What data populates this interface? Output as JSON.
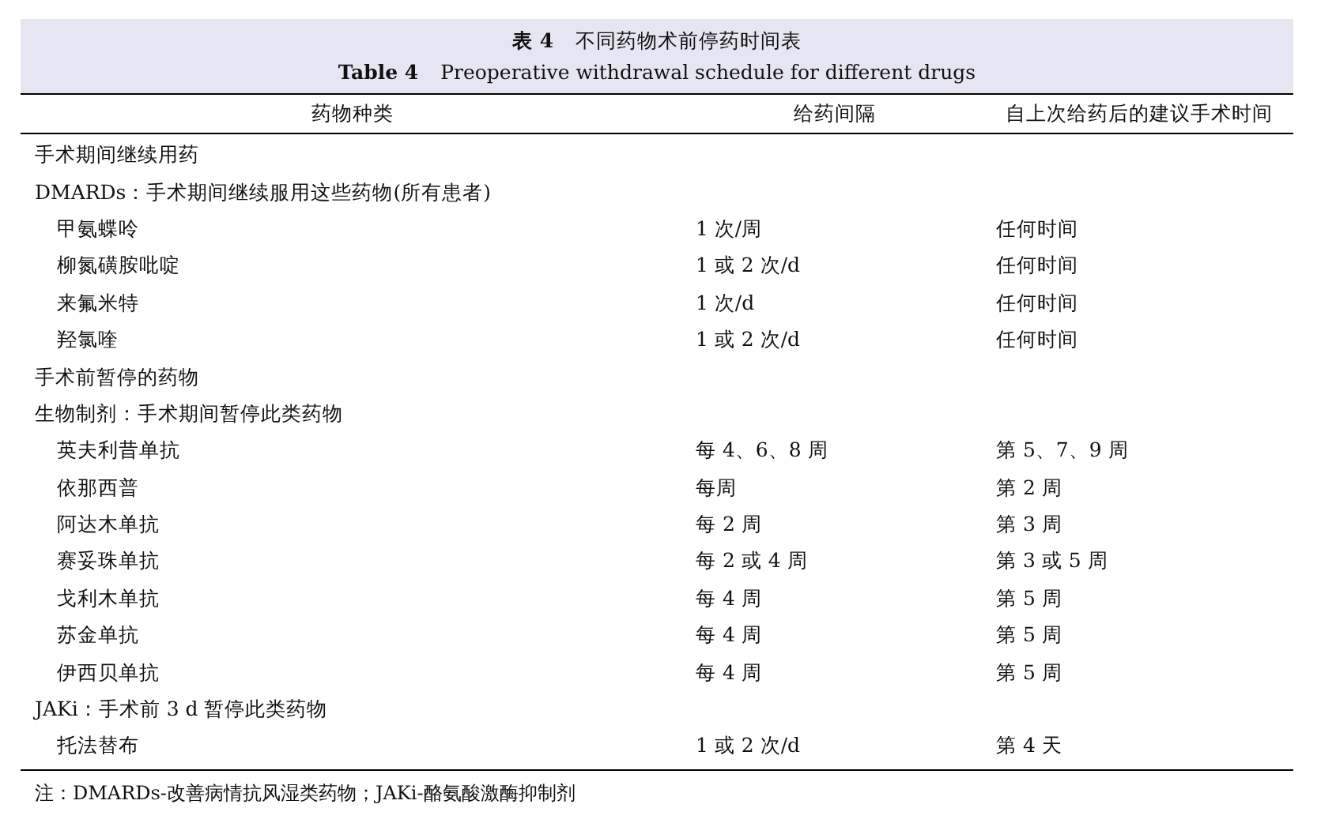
{
  "caption": {
    "label_zh": "表 4",
    "title_zh": "不同药物术前停药时间表",
    "label_en": "Table 4",
    "title_en": "Preoperative withdrawal schedule for different drugs"
  },
  "table": {
    "columns": [
      "药物种类",
      "给药间隔",
      "自上次给药后的建议手术时间"
    ],
    "rows": [
      {
        "kind": "group",
        "text": "手术期间继续用药"
      },
      {
        "kind": "group",
        "text": "DMARDs：手术期间继续服用这些药物(所有患者)"
      },
      {
        "kind": "drug",
        "cells": [
          "甲氨蝶呤",
          "1 次/周",
          "任何时间"
        ]
      },
      {
        "kind": "drug",
        "cells": [
          "柳氮磺胺吡啶",
          "1 或 2 次/d",
          "任何时间"
        ]
      },
      {
        "kind": "drug",
        "cells": [
          "来氟米特",
          "1 次/d",
          "任何时间"
        ]
      },
      {
        "kind": "drug",
        "cells": [
          "羟氯喹",
          "1 或 2 次/d",
          "任何时间"
        ]
      },
      {
        "kind": "group",
        "text": "手术前暂停的药物"
      },
      {
        "kind": "group",
        "text": "生物制剂：手术期间暂停此类药物"
      },
      {
        "kind": "drug",
        "cells": [
          "英夫利昔单抗",
          "每 4、6、8 周",
          "第 5、7、9 周"
        ]
      },
      {
        "kind": "drug",
        "cells": [
          "依那西普",
          "每周",
          "第 2 周"
        ]
      },
      {
        "kind": "drug",
        "cells": [
          "阿达木单抗",
          "每 2 周",
          "第 3 周"
        ]
      },
      {
        "kind": "drug",
        "cells": [
          "赛妥珠单抗",
          "每 2 或 4 周",
          "第 3 或 5 周"
        ]
      },
      {
        "kind": "drug",
        "cells": [
          "戈利木单抗",
          "每 4 周",
          "第 5 周"
        ]
      },
      {
        "kind": "drug",
        "cells": [
          "苏金单抗",
          "每 4 周",
          "第 5 周"
        ]
      },
      {
        "kind": "drug",
        "cells": [
          "伊西贝单抗",
          "每 4 周",
          "第 5 周"
        ]
      },
      {
        "kind": "group",
        "text": "JAKi：手术前 3 d 暂停此类药物"
      },
      {
        "kind": "drug",
        "cells": [
          "托法替布",
          "1 或 2 次/d",
          "第 4 天"
        ]
      }
    ]
  },
  "footnote": "注：DMARDs-改善病情抗风湿类药物；JAKi-酪氨酸激酶抑制剂"
}
